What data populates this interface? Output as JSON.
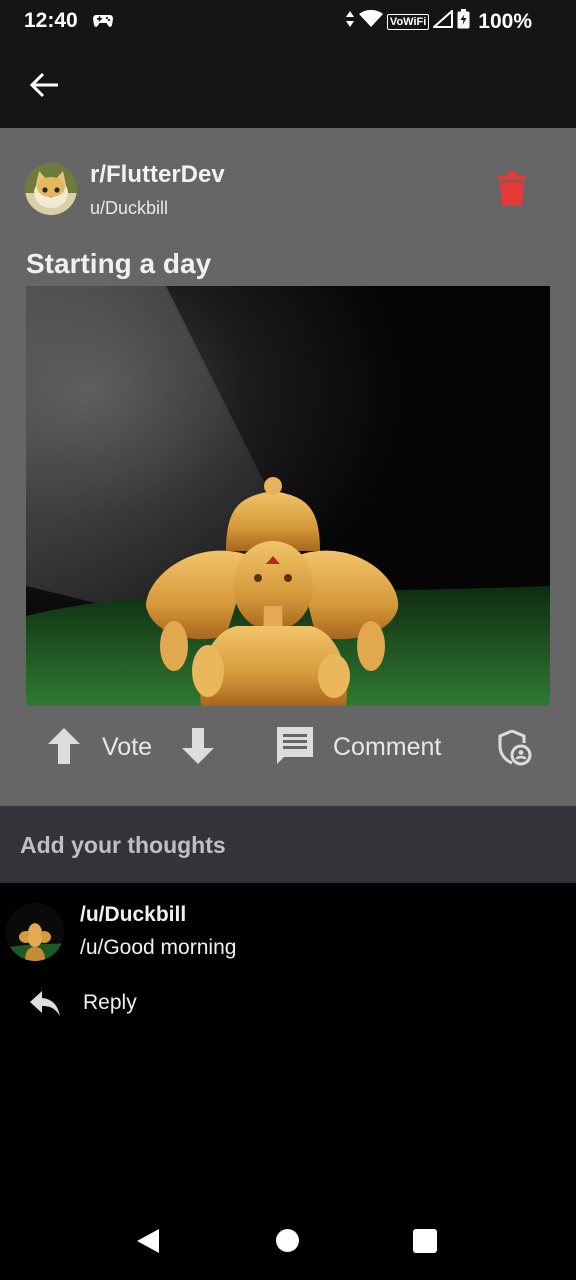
{
  "status_bar": {
    "time": "12:40",
    "network": "VoWiFi",
    "battery": "100%",
    "icons": [
      "gamepad-icon",
      "data-arrows-icon",
      "wifi-icon",
      "signal-icon",
      "battery-icon"
    ]
  },
  "app_bar": {
    "back_icon": "arrow-left-icon"
  },
  "post": {
    "community": "r/FlutterDev",
    "author": "u/Duckbill",
    "title": "Starting a day",
    "delete_icon": "trash-icon",
    "delete_color": "#e53935",
    "actions": {
      "vote_label": "Vote",
      "comment_label": "Comment",
      "upvote_icon": "arrow-up-icon",
      "downvote_icon": "arrow-down-icon",
      "comment_icon": "comment-icon",
      "mod_icon": "shield-icon"
    }
  },
  "add_comment": {
    "placeholder": "Add your thoughts"
  },
  "comments": [
    {
      "author": "/u/Duckbill",
      "text": "/u/Good morning",
      "reply_label": "Reply",
      "reply_icon": "reply-icon"
    }
  ],
  "colors": {
    "background": "#000000",
    "card": "#666666",
    "input_bar": "#333339",
    "accent_delete": "#e53935"
  }
}
